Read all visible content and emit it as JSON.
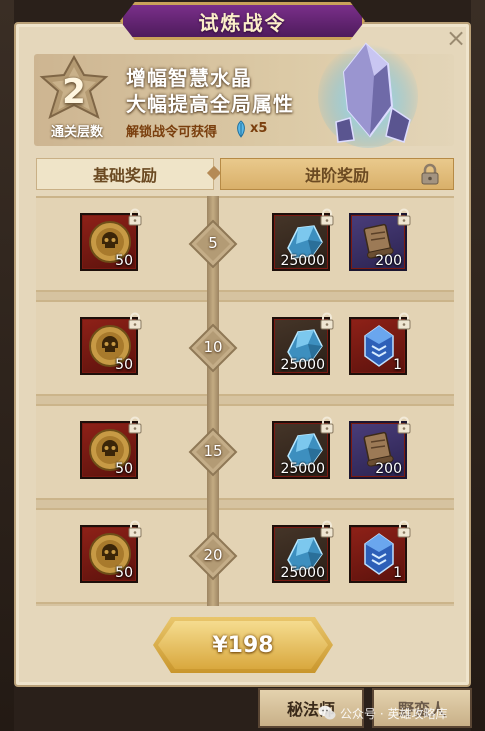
{
  "title": "试炼战令",
  "close_glyph": "×",
  "header": {
    "tier_number": "2",
    "tier_label": "通关层数",
    "bonus_line1": "增幅智慧水晶",
    "bonus_line2": "大幅提高全局属性",
    "unlock_text": "解锁战令可获得",
    "unlock_count": "x5",
    "icons": [
      "feather-icon",
      "crystal-icon",
      "badge-icon"
    ]
  },
  "tabs": {
    "basic": "基础奖励",
    "advanced": "进阶奖励"
  },
  "rows": [
    {
      "level": "5",
      "basic": {
        "icon": "skull-coin-icon",
        "count": "50"
      },
      "advanced": [
        {
          "icon": "blue-ore-icon",
          "count": "25000"
        },
        {
          "icon": "scroll-icon",
          "count": "200"
        }
      ]
    },
    {
      "level": "10",
      "basic": {
        "icon": "skull-coin-icon",
        "count": "50"
      },
      "advanced": [
        {
          "icon": "blue-ore-icon",
          "count": "25000"
        },
        {
          "icon": "blue-gem-icon",
          "count": "1"
        }
      ]
    },
    {
      "level": "15",
      "basic": {
        "icon": "skull-coin-icon",
        "count": "50"
      },
      "advanced": [
        {
          "icon": "blue-ore-icon",
          "count": "25000"
        },
        {
          "icon": "scroll-icon",
          "count": "200"
        }
      ]
    },
    {
      "level": "20",
      "basic": {
        "icon": "skull-coin-icon",
        "count": "50"
      },
      "advanced": [
        {
          "icon": "blue-ore-icon",
          "count": "25000"
        },
        {
          "icon": "blue-gem-icon",
          "count": "1"
        }
      ]
    }
  ],
  "price_label": "¥198",
  "bottom_buttons": {
    "mage": "秘法师",
    "wild": "野蛮人"
  },
  "watermark": "公众号 · 英雄攻略库",
  "colors": {
    "panel": "#e5d7bb",
    "title_banner": "#6a2678",
    "gold_button": "#d9a83e",
    "item_red": "#8e2118",
    "item_purple": "#4a3d7a"
  }
}
